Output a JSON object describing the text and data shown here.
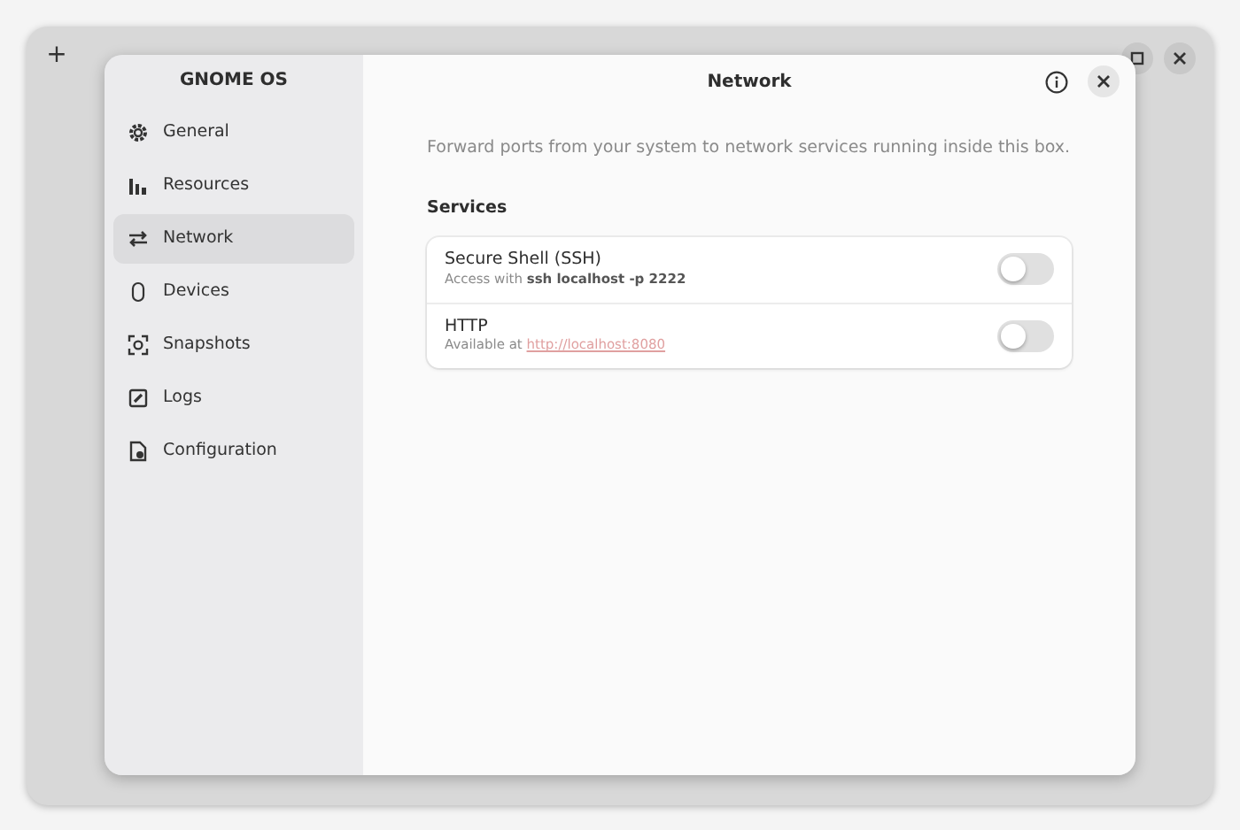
{
  "back_window": {
    "buttons": [
      {
        "kind": "add",
        "label": "+"
      },
      {
        "kind": "maximize"
      },
      {
        "kind": "close"
      }
    ]
  },
  "sidebar": {
    "title": "GNOME OS",
    "items": [
      {
        "label": "General",
        "kind": "gear",
        "selected": false
      },
      {
        "label": "Resources",
        "kind": "bars",
        "selected": false
      },
      {
        "label": "Network",
        "kind": "arrows",
        "selected": true
      },
      {
        "label": "Devices",
        "kind": "mouse",
        "selected": false
      },
      {
        "label": "Snapshots",
        "kind": "snapshot",
        "selected": false
      },
      {
        "label": "Logs",
        "kind": "log",
        "selected": false
      },
      {
        "label": "Configuration",
        "kind": "config",
        "selected": false
      }
    ]
  },
  "header": {
    "title": "Network"
  },
  "description": "Forward ports from your system to network services running inside this box.",
  "services": {
    "title": "Services",
    "rows": [
      {
        "title": "Secure Shell (SSH)",
        "subtitle": "Access with **ssh localhost -p 2222**",
        "on": false
      },
      {
        "title": "HTTP",
        "subtitle": "Available at",
        "link": "http://localhost:8080",
        "on": false
      }
    ]
  }
}
